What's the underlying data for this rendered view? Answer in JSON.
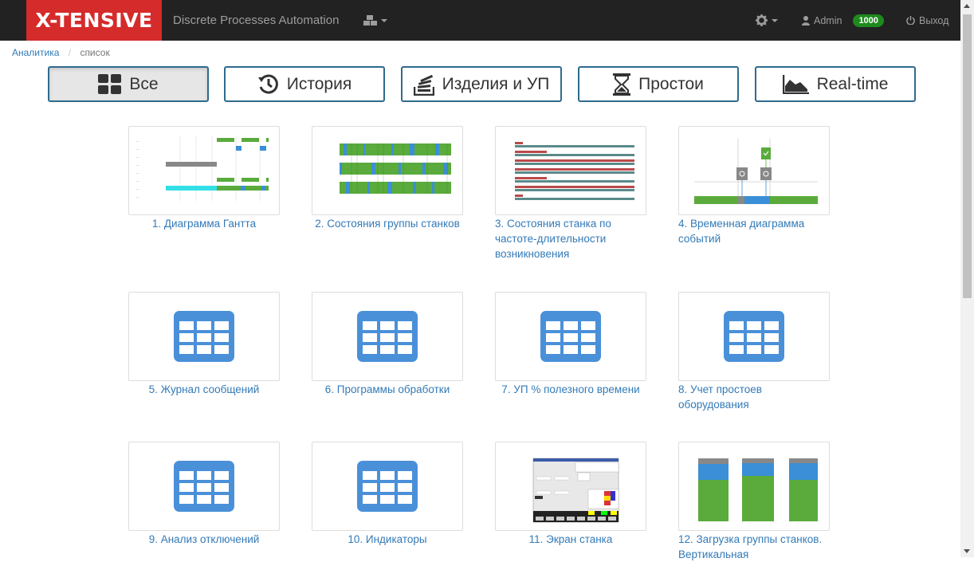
{
  "navbar": {
    "logo": "X-TENSIVE",
    "brand": "Discrete Processes Automation",
    "user": "Admin",
    "user_badge": "1000",
    "logout": "Выход"
  },
  "breadcrumb": {
    "root": "Аналитика",
    "separator": "/",
    "current": "список"
  },
  "filters": [
    {
      "label": "Все",
      "icon": "grid-icon",
      "active": true
    },
    {
      "label": "История",
      "icon": "history-icon"
    },
    {
      "label": "Изделия и УП",
      "icon": "stack-icon"
    },
    {
      "label": "Простои",
      "icon": "hourglass-icon"
    },
    {
      "label": "Real-time",
      "icon": "area-chart-icon"
    }
  ],
  "reports": [
    {
      "title": "1. Диаграмма Гантта",
      "thumb": "gantt-chart"
    },
    {
      "title": "2. Состояния группы станков",
      "thumb": "group-states-chart"
    },
    {
      "title": "3. Состояния станка по частоте-длительности возникновения",
      "thumb": "frequency-duration-chart"
    },
    {
      "title": "4. Временная диаграмма событий",
      "thumb": "event-timeline-chart"
    },
    {
      "title": "5. Журнал сообщений",
      "thumb": "table-icon"
    },
    {
      "title": "6. Программы обработки",
      "thumb": "table-icon"
    },
    {
      "title": "7. УП % полезного времени",
      "thumb": "table-icon"
    },
    {
      "title": "8. Учет простоев оборудования",
      "thumb": "table-icon"
    },
    {
      "title": "9. Анализ отключений",
      "thumb": "table-icon"
    },
    {
      "title": "10. Индикаторы",
      "thumb": "table-icon"
    },
    {
      "title": "11. Экран станка",
      "thumb": "machine-screen"
    },
    {
      "title": "12. Загрузка группы станков. Вертикальная",
      "thumb": "vertical-load-chart"
    }
  ],
  "colors": {
    "navbar_bg": "#222222",
    "logo_bg": "#d52b2b",
    "badge": "#1e8a1e",
    "link": "#337ab7",
    "table_icon": "#4a90d9",
    "chart_green": "#5aab3c",
    "chart_blue": "#3b8fd6",
    "chart_gray": "#888888",
    "chart_red": "#b94a4a",
    "chart_teal": "#5b8a8a"
  }
}
